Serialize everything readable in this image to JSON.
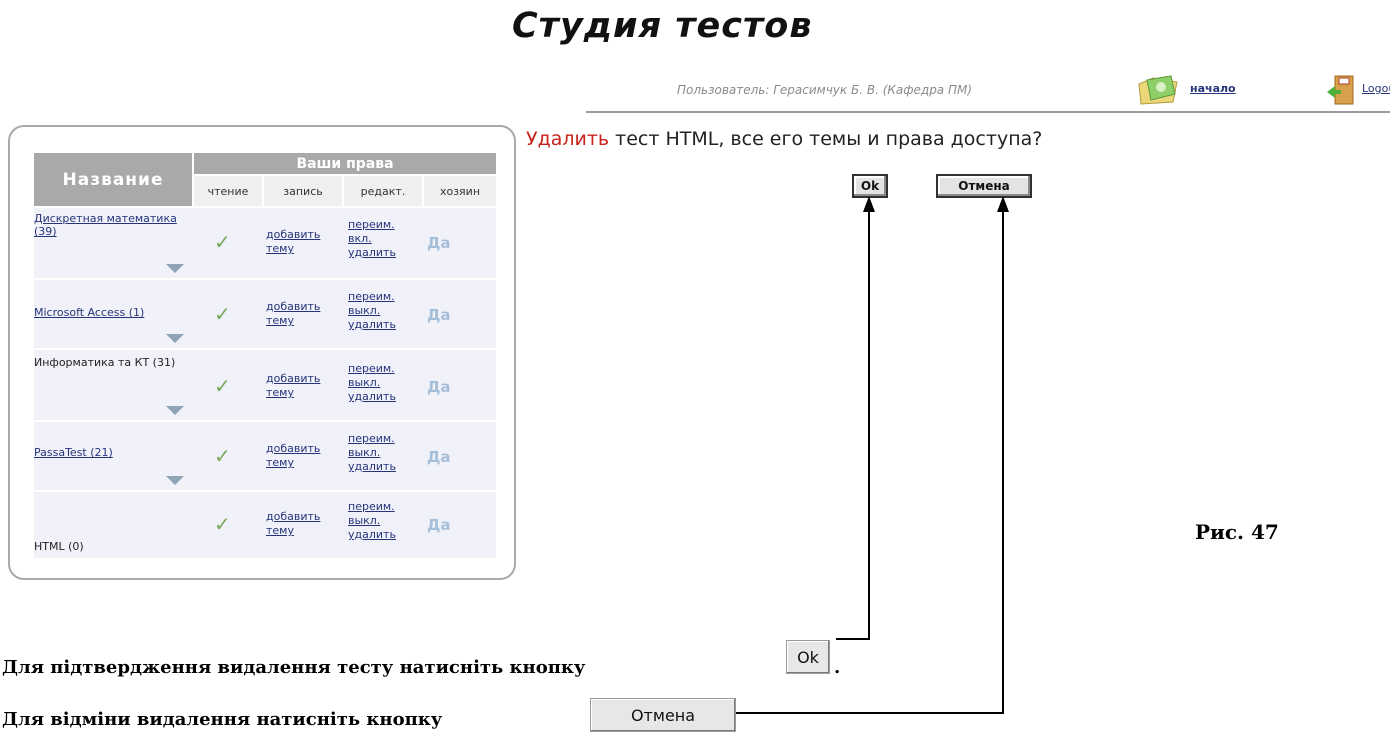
{
  "header": {
    "title": "Студия тестов",
    "user_text": "Пользователь: Герасимчук Б. В. (Кафедра ПМ)",
    "home_link": "начало",
    "logout_link": "Logout"
  },
  "table": {
    "col_name": "Название",
    "col_rights": "Ваши права",
    "subheaders": [
      "чтение",
      "запись",
      "редакт.",
      "хозяин"
    ],
    "rows": [
      {
        "name": "Дискретная математика (39)",
        "read_mark": "✓",
        "add": "добавить тему",
        "rename": "переим.",
        "toggle": "вкл.",
        "delete": "удалить",
        "owner": "Да"
      },
      {
        "name": "Microsoft Access (1)",
        "read_mark": "✓",
        "add": "добавить тему",
        "rename": "переим.",
        "toggle": "выкл.",
        "delete": "удалить",
        "owner": "Да"
      },
      {
        "name": "Информатика та КТ (31)",
        "read_mark": "✓",
        "add": "добавить тему",
        "rename": "переим.",
        "toggle": "выкл.",
        "delete": "удалить",
        "owner": "Да"
      },
      {
        "name": "PassaTest (21)",
        "read_mark": "✓",
        "add": "добавить тему",
        "rename": "переим.",
        "toggle": "выкл.",
        "delete": "удалить",
        "owner": "Да"
      },
      {
        "name": "HTML (0)",
        "read_mark": "✓",
        "add": "добавить тему",
        "rename": "переим.",
        "toggle": "выкл.",
        "delete": "удалить",
        "owner": "Да"
      }
    ]
  },
  "confirm": {
    "delete_word": "Удалить",
    "question_rest": "тест HTML, все его темы и права доступа?",
    "ok_label": "Ok",
    "cancel_label": "Отмена"
  },
  "figure_caption": "Рис. 47",
  "instructions": {
    "confirm_text": "Для підтвердження видалення тесту натисніть кнопку",
    "confirm_button": "Ok",
    "cancel_text": "Для відміни видалення натисніть кнопку",
    "cancel_button": "Отмена"
  }
}
